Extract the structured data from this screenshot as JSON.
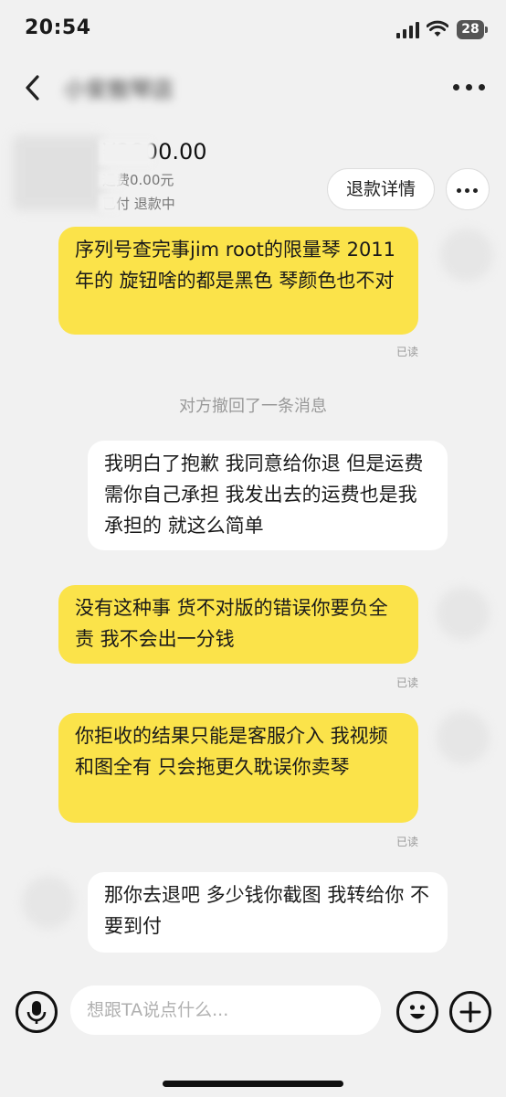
{
  "status_bar": {
    "time": "20:54",
    "battery": "28"
  },
  "nav": {
    "title": "小安敖琴店"
  },
  "product": {
    "price": "¥3800.00",
    "shipping": "运费0.00元",
    "status": "已付 退款中",
    "refund_button": "退款详情"
  },
  "messages": [
    {
      "side": "sent",
      "text": "序列号查完事jim root的限量琴 2011年的 旋钮啥的都是黑色 琴颜色也不对",
      "read": "已读"
    },
    {
      "side": "system",
      "text": "对方撤回了一条消息"
    },
    {
      "side": "recv",
      "text": "我明白了抱歉  我同意给你退  但是运费需你自己承担  我发出去的运费也是我承担的  就这么简单"
    },
    {
      "side": "sent",
      "text": "没有这种事 货不对版的错误你要负全责 我不会出一分钱",
      "read": "已读"
    },
    {
      "side": "sent",
      "text": "你拒收的结果只能是客服介入 我视频和图全有 只会拖更久耽误你卖琴",
      "read": "已读"
    },
    {
      "side": "recv",
      "text": "那你去退吧  多少钱你截图  我转给你  不要到付"
    }
  ],
  "input": {
    "placeholder": "想跟TA说点什么..."
  },
  "colors": {
    "sent_bubble": "#fbe34a",
    "recv_bubble": "#ffffff",
    "background": "#f1f1f1"
  }
}
